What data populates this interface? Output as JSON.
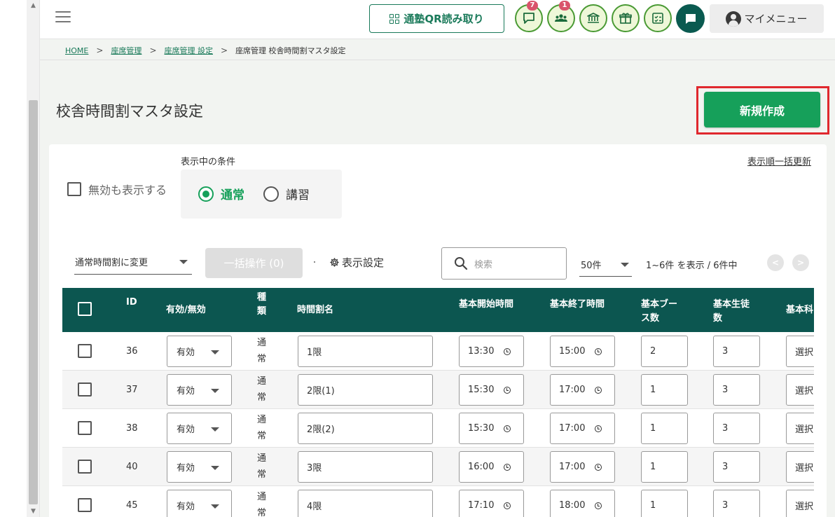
{
  "header": {
    "qr_button_label": "通塾QR読み取り",
    "messages_badge": "7",
    "students_badge": "1",
    "my_menu_label": "マイメニュー"
  },
  "breadcrumb": {
    "items": [
      "HOME",
      "座席管理",
      "座席管理 設定",
      "座席管理 校舎時間割マスタ設定"
    ]
  },
  "page": {
    "title": "校舎時間割マスタ設定",
    "new_button_label": "新規作成"
  },
  "filters": {
    "show_invalid_label": "無効も表示する",
    "condition_label": "表示中の条件",
    "radio_normal": "通常",
    "radio_course": "講習",
    "sort_update_label": "表示順一括更新"
  },
  "toolbar": {
    "bulk_select_value": "通常時間割に変更",
    "bulk_button_label": "一括操作 (0)",
    "display_settings_label": "表示設定",
    "search_placeholder": "検索",
    "per_page_value": "50件",
    "range_info": "1~6件 を表示 / 6件中"
  },
  "table": {
    "headers": {
      "id": "ID",
      "status": "有効/無効",
      "kind_1": "種",
      "kind_2": "類",
      "name": "時間割名",
      "start": "基本開始時間",
      "end": "基本終了時間",
      "booth_1": "基本ブー",
      "booth_2": "ス数",
      "students_1": "基本生徒",
      "students_2": "数",
      "subject": "基本科"
    },
    "rows": [
      {
        "id": "36",
        "status": "有効",
        "kind_1": "通",
        "kind_2": "常",
        "name": "1限",
        "start": "13:30",
        "end": "15:00",
        "booths": "2",
        "students": "3",
        "subject": "選択"
      },
      {
        "id": "37",
        "status": "有効",
        "kind_1": "通",
        "kind_2": "常",
        "name": "2限(1)",
        "start": "15:30",
        "end": "17:00",
        "booths": "1",
        "students": "3",
        "subject": "選択"
      },
      {
        "id": "38",
        "status": "有効",
        "kind_1": "通",
        "kind_2": "常",
        "name": "2限(2)",
        "start": "15:30",
        "end": "17:00",
        "booths": "1",
        "students": "3",
        "subject": "選択"
      },
      {
        "id": "40",
        "status": "有効",
        "kind_1": "通",
        "kind_2": "常",
        "name": "3限",
        "start": "16:00",
        "end": "17:00",
        "booths": "1",
        "students": "3",
        "subject": "選択"
      },
      {
        "id": "45",
        "status": "有効",
        "kind_1": "通",
        "kind_2": "常",
        "name": "4限",
        "start": "17:10",
        "end": "18:00",
        "booths": "1",
        "students": "3",
        "subject": "選択"
      }
    ]
  },
  "colors": {
    "accent_green": "#16a05a",
    "header_teal": "#0c5650",
    "highlight_red": "#e0282e",
    "badge_pink": "#d9546b"
  }
}
